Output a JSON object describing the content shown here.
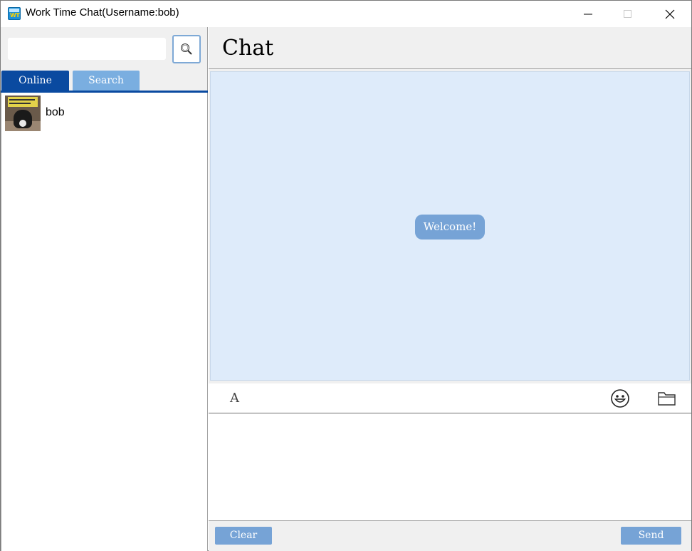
{
  "window": {
    "title": "Work Time Chat(Username:bob)",
    "app_icon": "app-icon",
    "app_icon_text": "WT"
  },
  "left": {
    "search": {
      "value": "",
      "placeholder": "",
      "button_icon": "search-icon"
    },
    "tabs": [
      {
        "label": "Online",
        "active": true
      },
      {
        "label": "Search",
        "active": false
      }
    ],
    "users": [
      {
        "name": "bob",
        "avatar": "avatar-photo"
      }
    ]
  },
  "chat": {
    "title": "Chat",
    "messages": [
      {
        "text": "Welcome!",
        "type": "system"
      }
    ],
    "toolbar": {
      "font_label": "A",
      "emoji_icon": "smiley-icon",
      "file_icon": "folder-icon"
    },
    "input_value": "",
    "clear_label": "Clear",
    "send_label": "Send"
  },
  "colors": {
    "accent_dark": "#0a4aa0",
    "accent_light": "#76a3d6",
    "chat_bg": "#deebfa"
  }
}
